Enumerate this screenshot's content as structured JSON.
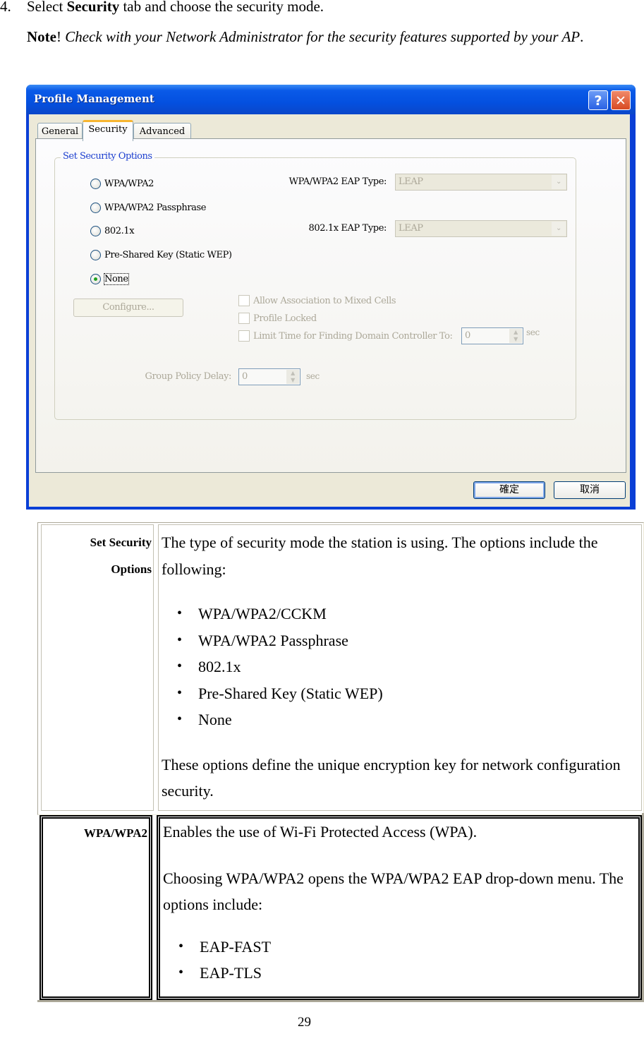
{
  "intro": {
    "step_number": "4.",
    "step_prefix": "Select ",
    "step_bold": "Security",
    "step_suffix": " tab and choose the security mode.",
    "note_label": "Note",
    "note_bang": "!",
    "note_text": " Check with your Network Administrator for the security features supported by your AP",
    "note_end": "."
  },
  "window": {
    "title": "Profile Management",
    "help_icon": "?",
    "close_icon": "✕",
    "tabs": [
      {
        "label": "General",
        "active": false
      },
      {
        "label": "Security",
        "active": true
      },
      {
        "label": "Advanced",
        "active": false
      }
    ],
    "group_title": "Set Security Options",
    "radio_options": [
      {
        "label": "WPA/WPA2",
        "checked": false
      },
      {
        "label": "WPA/WPA2 Passphrase",
        "checked": false
      },
      {
        "label": "802.1x",
        "checked": false
      },
      {
        "label": "Pre-Shared Key (Static WEP)",
        "checked": false
      },
      {
        "label": "None",
        "checked": true
      }
    ],
    "wpa_eap_label": "WPA/WPA2 EAP Type:",
    "wpa_eap_value": "LEAP",
    "dot1x_eap_label": "802.1x EAP Type:",
    "dot1x_eap_value": "LEAP",
    "configure_label": "Configure...",
    "checkboxes": [
      {
        "label": "Allow Association to Mixed Cells",
        "checked": false
      },
      {
        "label": "Profile Locked",
        "checked": false
      },
      {
        "label": "Limit Time for Finding Domain Controller To:",
        "checked": false
      }
    ],
    "limit_time_value": "0",
    "limit_time_unit": "sec",
    "group_policy_label": "Group Policy Delay:",
    "group_policy_value": "0",
    "group_policy_unit": "sec",
    "ok_label": "確定",
    "cancel_label": "取消",
    "spin_up": "▲",
    "spin_down": "▼",
    "combo_arrow": "⌄"
  },
  "table": {
    "rows": [
      {
        "label_line1": "Set Security",
        "label_line2": "Options",
        "intro": "The type of security mode the station is using. The options include the following:",
        "items": [
          "WPA/WPA2/CCKM",
          "WPA/WPA2 Passphrase",
          "802.1x",
          "Pre-Shared Key (Static WEP)",
          "None"
        ],
        "outro": "These options define the unique encryption key for network configuration security."
      },
      {
        "label": "WPA/WPA2",
        "para1": "Enables the use of Wi-Fi Protected Access (WPA).",
        "para2": "Choosing WPA/WPA2 opens the WPA/WPA2 EAP drop-down menu. The options include:",
        "items": [
          "EAP-FAST",
          "EAP-TLS"
        ]
      }
    ]
  },
  "page_number": "29"
}
